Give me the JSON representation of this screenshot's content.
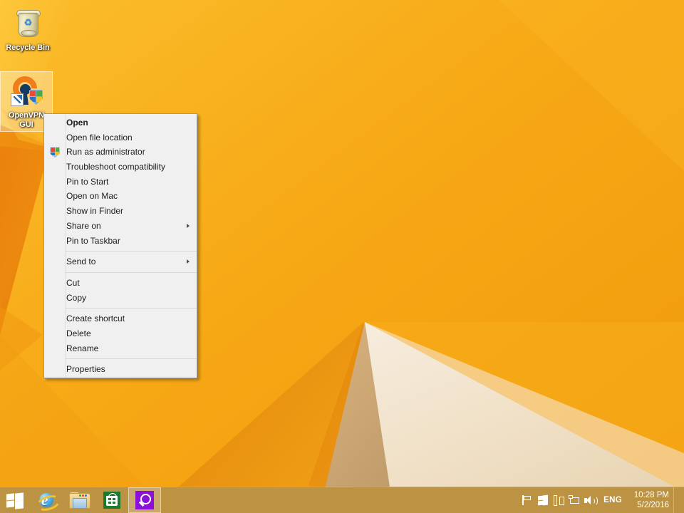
{
  "desktop": {
    "wallpaper_colors": {
      "orange_light": "#f9b528",
      "orange_mid": "#f5a314",
      "orange_deep": "#ef8c10",
      "orange_shadow": "#e07c0d",
      "cream": "#f2e2c8",
      "cream_shade": "#e6d2b4",
      "taupe": "#c7a878"
    },
    "icons": [
      {
        "name": "recycle-bin",
        "label": "Recycle Bin",
        "selected": false
      },
      {
        "name": "openvpn-gui",
        "label": "OpenVPN GUI",
        "selected": true
      }
    ]
  },
  "context_menu": {
    "target": "OpenVPN GUI",
    "groups": [
      {
        "items": [
          {
            "label": "Open",
            "bold": true,
            "submenu": false,
            "shield": false
          },
          {
            "label": "Open file location",
            "bold": false,
            "submenu": false,
            "shield": false
          },
          {
            "label": "Run as administrator",
            "bold": false,
            "submenu": false,
            "shield": true
          },
          {
            "label": "Troubleshoot compatibility",
            "bold": false,
            "submenu": false,
            "shield": false
          },
          {
            "label": "Pin to Start",
            "bold": false,
            "submenu": false,
            "shield": false
          },
          {
            "label": "Open on Mac",
            "bold": false,
            "submenu": false,
            "shield": false
          },
          {
            "label": "Show in Finder",
            "bold": false,
            "submenu": false,
            "shield": false
          },
          {
            "label": "Share on",
            "bold": false,
            "submenu": true,
            "shield": false
          },
          {
            "label": "Pin to Taskbar",
            "bold": false,
            "submenu": false,
            "shield": false
          }
        ]
      },
      {
        "items": [
          {
            "label": "Send to",
            "bold": false,
            "submenu": true,
            "shield": false
          }
        ]
      },
      {
        "items": [
          {
            "label": "Cut",
            "bold": false,
            "submenu": false,
            "shield": false
          },
          {
            "label": "Copy",
            "bold": false,
            "submenu": false,
            "shield": false
          }
        ]
      },
      {
        "items": [
          {
            "label": "Create shortcut",
            "bold": false,
            "submenu": false,
            "shield": false
          },
          {
            "label": "Delete",
            "bold": false,
            "submenu": false,
            "shield": false
          },
          {
            "label": "Rename",
            "bold": false,
            "submenu": false,
            "shield": false
          }
        ]
      },
      {
        "items": [
          {
            "label": "Properties",
            "bold": false,
            "submenu": false,
            "shield": false
          }
        ]
      }
    ]
  },
  "taskbar": {
    "background_color": "#bb9343",
    "buttons": [
      {
        "name": "start-button",
        "icon": "windows-start-icon",
        "title": "Start",
        "active": false
      },
      {
        "name": "internet-explorer-button",
        "icon": "internet-explorer-icon",
        "title": "Internet Explorer",
        "active": false
      },
      {
        "name": "file-explorer-button",
        "icon": "file-explorer-icon",
        "title": "File Explorer",
        "active": false
      },
      {
        "name": "store-button",
        "icon": "store-icon",
        "title": "Store",
        "active": false
      },
      {
        "name": "search-button",
        "icon": "search-icon",
        "title": "Search",
        "active": true
      }
    ],
    "tray": {
      "icons": [
        {
          "name": "action-center-flag-icon",
          "title": "Action Center"
        },
        {
          "name": "windows-tray-icon",
          "title": "Windows"
        },
        {
          "name": "device-icon",
          "title": "Devices"
        },
        {
          "name": "network-icon",
          "title": "Network"
        },
        {
          "name": "volume-icon",
          "title": "Volume"
        }
      ],
      "language": "ENG",
      "clock": {
        "time": "10:28 PM",
        "date": "5/2/2016"
      }
    }
  }
}
